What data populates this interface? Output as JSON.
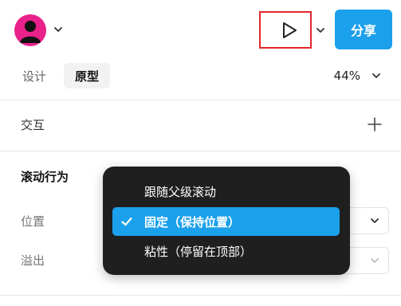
{
  "header": {
    "avatar_icon": "user-avatar-icon",
    "preview_icon": "play-icon",
    "share_label": "分享",
    "accent_color": "#1ba0ec",
    "avatar_color": "#e9218a",
    "highlight_border_color": "#e0272d"
  },
  "tabs": [
    {
      "label": "设计",
      "active": false
    },
    {
      "label": "原型",
      "active": true
    }
  ],
  "zoom": {
    "value": "44%"
  },
  "sections": {
    "interaction": {
      "title": "交互",
      "add_icon": "plus-icon"
    },
    "scroll_behavior": {
      "title": "滚动行为",
      "position_label": "位置",
      "overflow_label": "溢出"
    }
  },
  "menu": {
    "items": [
      {
        "label": "跟随父级滚动",
        "selected": false
      },
      {
        "label": "固定（保持位置）",
        "selected": true
      },
      {
        "label": "粘性（停留在顶部）",
        "selected": false
      }
    ]
  }
}
